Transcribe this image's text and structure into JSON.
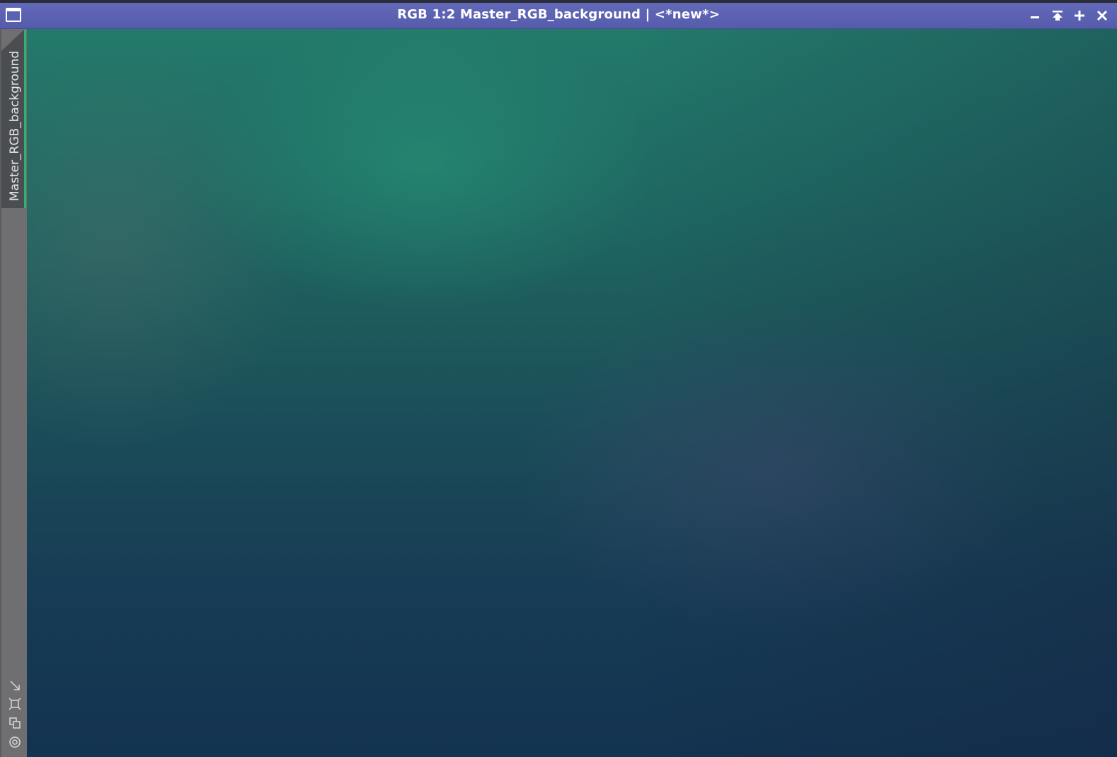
{
  "window": {
    "title": "RGB 1:2 Master_RGB_background | <*new*>"
  },
  "controls": {
    "minimize_glyph": "−",
    "maximize_glyph": "+",
    "close_glyph": "✕"
  },
  "sidebar": {
    "view_tab_label": "Master_RGB_background",
    "accent_color": "#2fb36a"
  },
  "colors": {
    "titlebar": "#5c62b0",
    "image_top": "#237a6b",
    "image_bottom": "#133350"
  },
  "icons": [
    "window-icon",
    "minimize-icon",
    "shade-icon",
    "maximize-icon",
    "close-icon",
    "fit-view-icon",
    "zoom-frame-icon",
    "clone-view-icon",
    "preview-icon"
  ]
}
